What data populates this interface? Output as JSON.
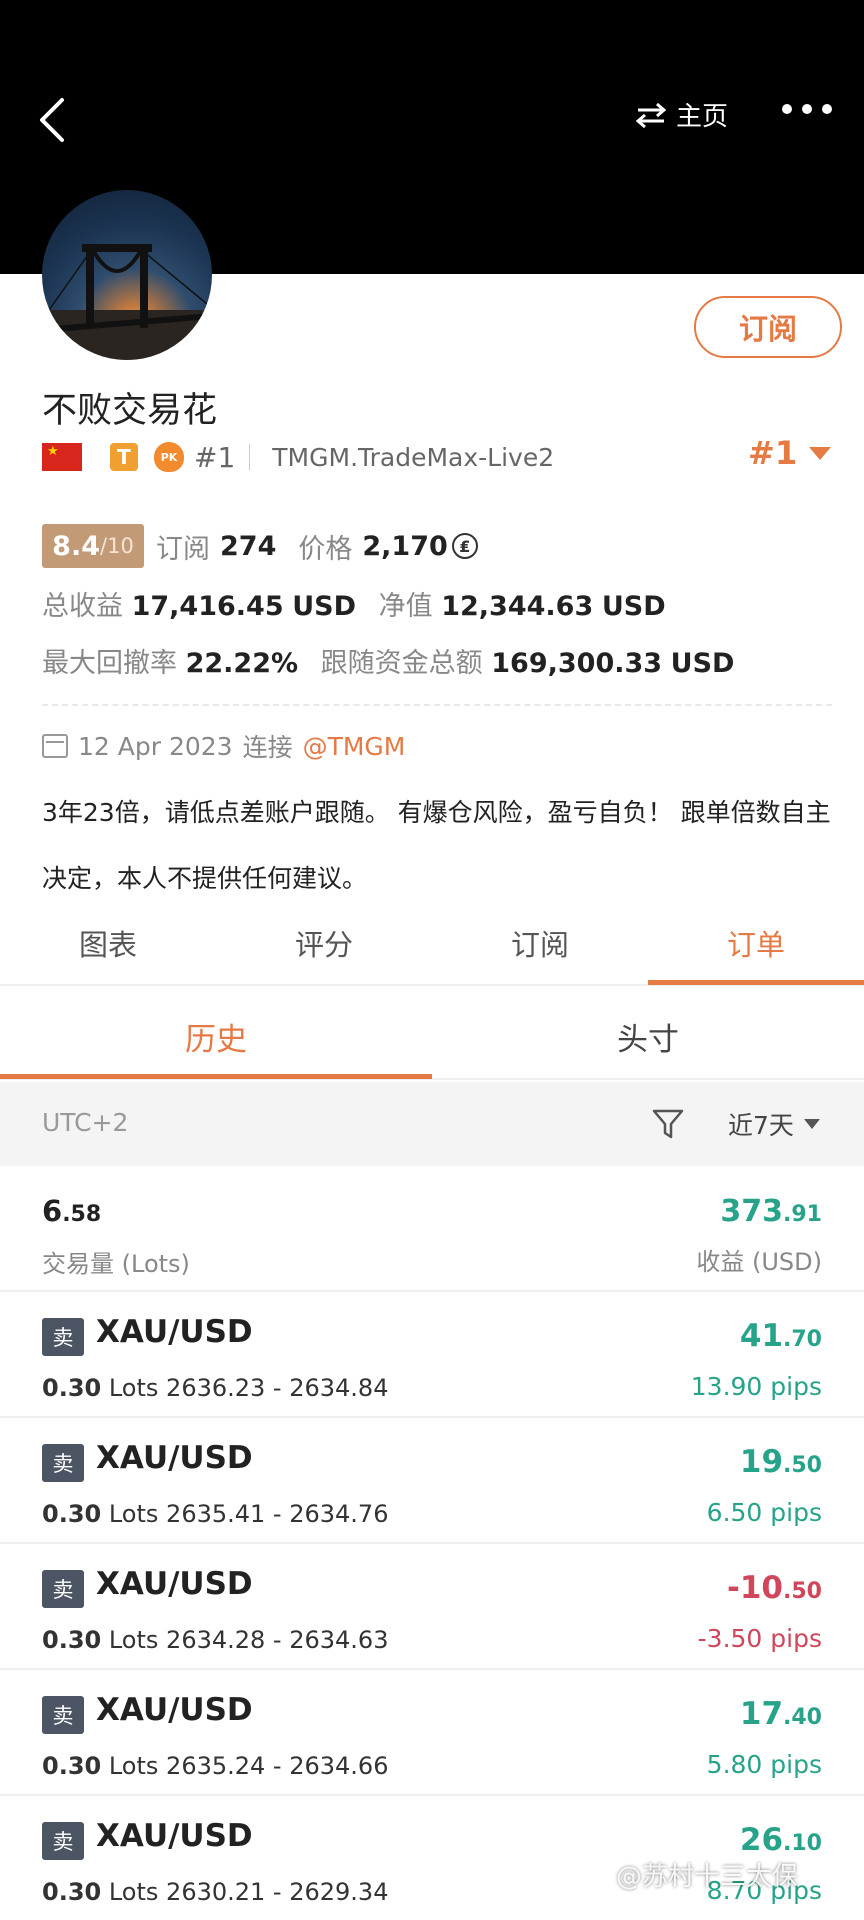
{
  "header": {
    "switch_label": "主页"
  },
  "profile": {
    "name": "不败交易花",
    "subscribe_label": "订阅",
    "rank_small": "#1",
    "server": "TMGM.TradeMax-Live2",
    "rank_big": "#1",
    "score": "8.4",
    "score_max": "/10",
    "subs_label": "订阅",
    "subs_value": "274",
    "price_label": "价格",
    "price_value": "2,170",
    "price_icon": "₤",
    "total_profit_label": "总收益",
    "total_profit_int": "17,416",
    "total_profit_dec": ".45",
    "total_profit_unit": "USD",
    "equity_label": "净值",
    "equity_int": "12,344",
    "equity_dec": ".63",
    "equity_unit": "USD",
    "drawdown_label": "最大回撤率",
    "drawdown_value": "22.22%",
    "follow_label": "跟随资金总额",
    "follow_int": "169,300",
    "follow_dec": ".33",
    "follow_unit": "USD",
    "date": "12 Apr 2023",
    "connect_label": "连接",
    "broker": "@TMGM",
    "description": "3年23倍，请低点差账户跟随。 有爆仓风险，盈亏自负！ 跟单倍数自主决定，本人不提供任何建议。"
  },
  "tabs": [
    {
      "label": "图表"
    },
    {
      "label": "评分"
    },
    {
      "label": "订阅"
    },
    {
      "label": "订单"
    }
  ],
  "subtabs": [
    {
      "label": "历史"
    },
    {
      "label": "头寸"
    }
  ],
  "filter": {
    "timezone": "UTC+2",
    "period": "近7天"
  },
  "summary": {
    "volume_int": "6",
    "volume_dec": ".58",
    "volume_label": "交易量 (Lots)",
    "profit_int": "373",
    "profit_dec": ".91",
    "profit_label": "收益 (USD)"
  },
  "trades": [
    {
      "side": "卖",
      "symbol": "XAU/USD",
      "lots": "0.30",
      "lots_unit": "Lots",
      "range": "2636.23 - 2634.84",
      "pl_int": "41",
      "pl_dec": ".70",
      "pips": "13.90 pips"
    },
    {
      "side": "卖",
      "symbol": "XAU/USD",
      "lots": "0.30",
      "lots_unit": "Lots",
      "range": "2635.41 - 2634.76",
      "pl_int": "19",
      "pl_dec": ".50",
      "pips": "6.50 pips"
    },
    {
      "side": "卖",
      "symbol": "XAU/USD",
      "lots": "0.30",
      "lots_unit": "Lots",
      "range": "2634.28 - 2634.63",
      "pl_int": "-10",
      "pl_dec": ".50",
      "pips": "-3.50 pips"
    },
    {
      "side": "卖",
      "symbol": "XAU/USD",
      "lots": "0.30",
      "lots_unit": "Lots",
      "range": "2635.24 - 2634.66",
      "pl_int": "17",
      "pl_dec": ".40",
      "pips": "5.80 pips"
    },
    {
      "side": "卖",
      "symbol": "XAU/USD",
      "lots": "0.30",
      "lots_unit": "Lots",
      "range": "2630.21 - 2629.34",
      "pl_int": "26",
      "pl_dec": ".10",
      "pips": "8.70 pips"
    }
  ],
  "watermark": "@苏村十三太保",
  "colors": {
    "accent": "#e57a45",
    "positive": "#27a38a",
    "negative": "#d0465a",
    "score_bg": "#c29b76"
  }
}
